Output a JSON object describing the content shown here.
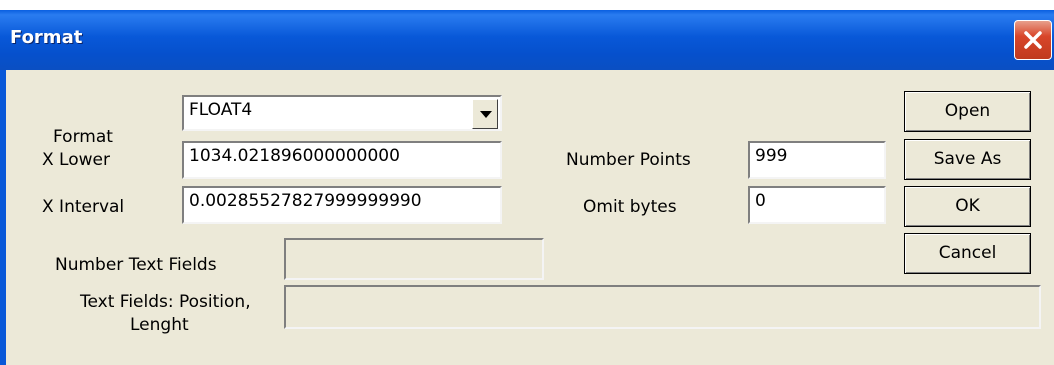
{
  "window": {
    "title": "Format"
  },
  "form": {
    "format_label": "Format",
    "format_value": "FLOAT4",
    "x_lower_label": "X Lower",
    "x_lower_value": "1034.021896000000000",
    "x_interval_label": "X Interval",
    "x_interval_value": "0.00285527827999999990",
    "number_points_label": "Number Points",
    "number_points_value": "999",
    "omit_bytes_label": "Omit bytes",
    "omit_bytes_value": "0",
    "number_text_fields_label": "Number Text Fields",
    "number_text_fields_value": "",
    "text_fields_label_line1": "Text Fields: Position,",
    "text_fields_label_line2": "Lenght",
    "text_fields_value": ""
  },
  "buttons": {
    "open": "Open",
    "save_as": "Save As",
    "ok": "OK",
    "cancel": "Cancel"
  },
  "icons": {
    "close": "close-icon",
    "dropdown": "chevron-down-icon"
  }
}
